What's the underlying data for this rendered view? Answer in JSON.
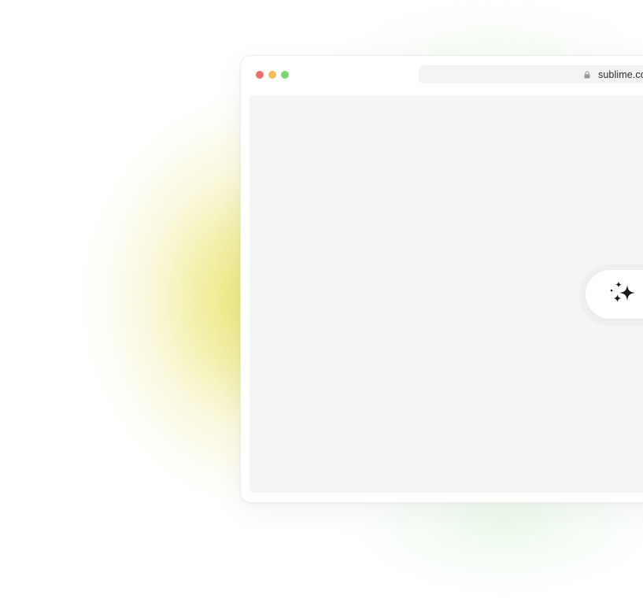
{
  "browser": {
    "window_controls": [
      {
        "name": "close",
        "color": "#ec6f6c"
      },
      {
        "name": "minimize",
        "color": "#f3bd5c"
      },
      {
        "name": "maximize",
        "color": "#7ed56f"
      }
    ],
    "address_bar": {
      "icon": "lock-icon",
      "url": "sublime.cor"
    }
  },
  "content": {
    "ai_button": {
      "icon": "sparkles-icon"
    }
  },
  "colors": {
    "glow_primary": "#ebe66e",
    "glow_secondary": "#d7f5d7",
    "viewport_bg": "#f5f5f5"
  }
}
